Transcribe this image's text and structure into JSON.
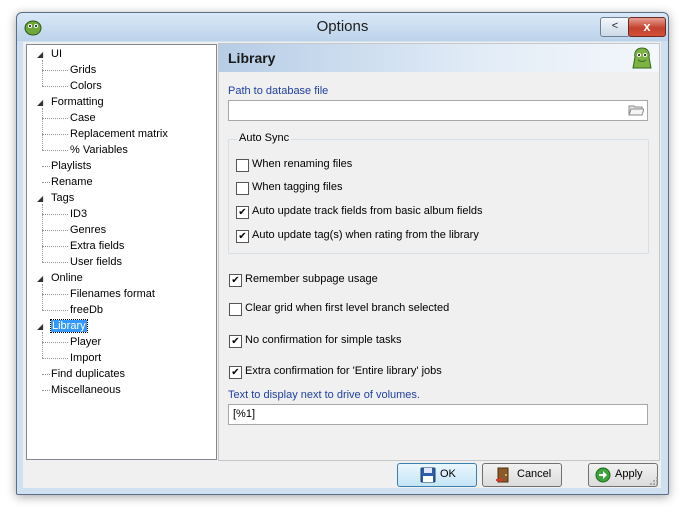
{
  "window": {
    "title": "Options",
    "min_label": "<",
    "close_label": "x"
  },
  "tree": {
    "items": [
      {
        "label": "UI",
        "level": 0,
        "expanded": true,
        "selected": false
      },
      {
        "label": "Grids",
        "level": 1,
        "selected": false
      },
      {
        "label": "Colors",
        "level": 1,
        "selected": false
      },
      {
        "label": "Formatting",
        "level": 0,
        "expanded": true,
        "selected": false
      },
      {
        "label": "Case",
        "level": 1,
        "selected": false
      },
      {
        "label": "Replacement matrix",
        "level": 1,
        "selected": false
      },
      {
        "label": "% Variables",
        "level": 1,
        "selected": false
      },
      {
        "label": "Playlists",
        "level": 0,
        "selected": false
      },
      {
        "label": "Rename",
        "level": 0,
        "selected": false
      },
      {
        "label": "Tags",
        "level": 0,
        "expanded": true,
        "selected": false
      },
      {
        "label": "ID3",
        "level": 1,
        "selected": false
      },
      {
        "label": "Genres",
        "level": 1,
        "selected": false
      },
      {
        "label": "Extra fields",
        "level": 1,
        "selected": false
      },
      {
        "label": "User fields",
        "level": 1,
        "selected": false
      },
      {
        "label": "Online",
        "level": 0,
        "expanded": true,
        "selected": false
      },
      {
        "label": "Filenames format",
        "level": 1,
        "selected": false
      },
      {
        "label": "freeDb",
        "level": 1,
        "selected": false
      },
      {
        "label": "Library",
        "level": 0,
        "expanded": true,
        "selected": true
      },
      {
        "label": "Player",
        "level": 1,
        "selected": false
      },
      {
        "label": "Import",
        "level": 1,
        "selected": false
      },
      {
        "label": "Find duplicates",
        "level": 0,
        "selected": false
      },
      {
        "label": "Miscellaneous",
        "level": 0,
        "selected": false
      }
    ]
  },
  "panel": {
    "title": "Library",
    "db_path_label": "Path to database file",
    "db_path_value": "",
    "auto_sync": {
      "title": "Auto Sync",
      "options": [
        {
          "label": "When renaming files",
          "checked": false
        },
        {
          "label": "When tagging files",
          "checked": false
        },
        {
          "label": "Auto update track fields from basic album fields",
          "checked": true
        },
        {
          "label": "Auto update tag(s) when rating from the library",
          "checked": true
        }
      ]
    },
    "options": [
      {
        "label": "Remember subpage usage",
        "checked": true
      },
      {
        "label": "Clear grid when first level branch selected",
        "checked": false
      },
      {
        "label": "No confirmation for simple tasks",
        "checked": true
      },
      {
        "label": "Extra confirmation for 'Entire library' jobs",
        "checked": true
      }
    ],
    "drive_label": "Text to display next to drive of volumes.",
    "drive_value": "[%1]"
  },
  "buttons": {
    "ok": "OK",
    "cancel": "Cancel",
    "apply": "Apply"
  },
  "icons": [
    "app-icon",
    "folder-icon",
    "mascot-icon",
    "floppy-icon",
    "door-icon",
    "arrow-icon"
  ],
  "colors": {
    "selection": "#3399ff",
    "label_blue": "#1f3f9f",
    "close": "#c4422d"
  }
}
